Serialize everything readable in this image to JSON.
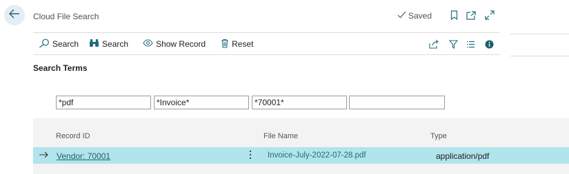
{
  "header": {
    "title": "Cloud File Search",
    "saved_label": "Saved",
    "icons": [
      "back-arrow-icon",
      "checkmark-icon",
      "bookmark-icon",
      "open-new-window-icon",
      "expand-icon"
    ]
  },
  "toolbar": {
    "search1_label": "Search",
    "search2_label": "Search",
    "show_record_label": "Show Record",
    "reset_label": "Reset",
    "right_icons": [
      "share-icon",
      "filter-icon",
      "list-icon",
      "info-icon"
    ]
  },
  "search_terms": {
    "title": "Search Terms",
    "terms": [
      "*pdf",
      "*Invoice*",
      "*70001*",
      ""
    ]
  },
  "results": {
    "columns": [
      "Record ID",
      "File Name",
      "Type"
    ],
    "rows": [
      {
        "record_id": "Vendor: 70001",
        "file_name": "Invoice-July-2022-07-28.pdf",
        "type": "application/pdf"
      }
    ]
  },
  "colors": {
    "accent": "#1f6c7a",
    "selected_row": "#b1e4ec",
    "back_button_bg": "#e3eef4",
    "grid_bg": "#f3f3f3",
    "info_icon": "#1a5f6f"
  }
}
